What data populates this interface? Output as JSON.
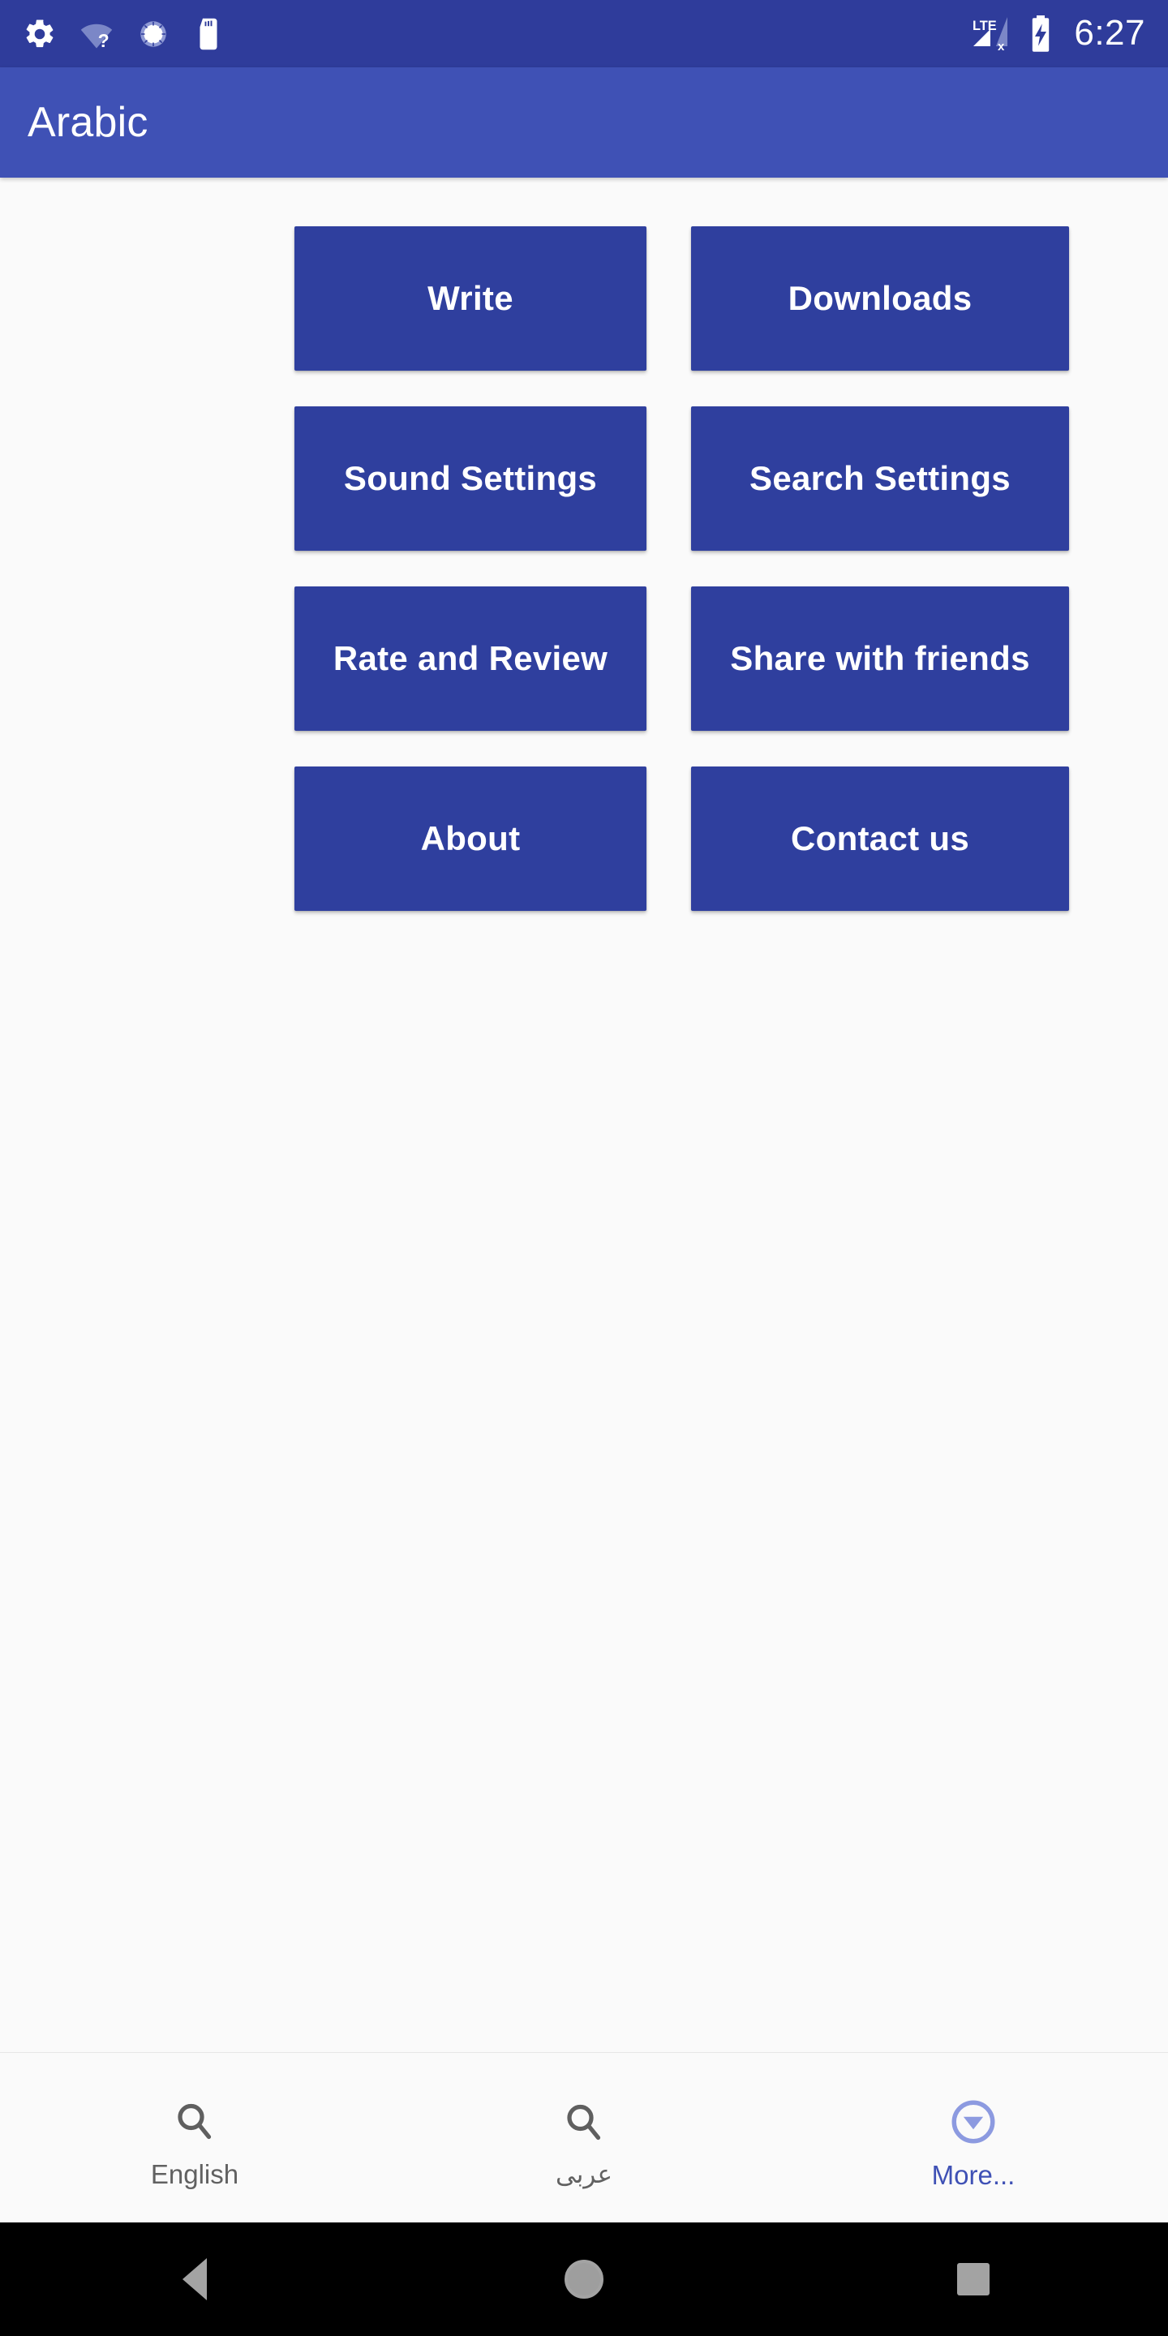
{
  "status_bar": {
    "time": "6:27",
    "icons": [
      {
        "name": "settings-gear-icon"
      },
      {
        "name": "wifi-unknown-icon"
      },
      {
        "name": "sync-circle-icon"
      },
      {
        "name": "sd-card-icon"
      }
    ],
    "right_icons": [
      {
        "name": "lte-signal-no-service-icon",
        "label": "LTE"
      },
      {
        "name": "battery-charging-icon"
      }
    ],
    "background_color": "#2f3c9b"
  },
  "app_bar": {
    "title": "Arabic",
    "background_color": "#3f51b5",
    "text_color": "#ffffff"
  },
  "main": {
    "button_color": "#2f3f9e",
    "button_text_color": "#ffffff",
    "buttons": [
      {
        "label": "Write",
        "name": "write-button"
      },
      {
        "label": "Downloads",
        "name": "downloads-button"
      },
      {
        "label": "Sound Settings",
        "name": "sound-settings-button"
      },
      {
        "label": "Search Settings",
        "name": "search-settings-button"
      },
      {
        "label": "Rate and Review",
        "name": "rate-and-review-button"
      },
      {
        "label": "Share with friends",
        "name": "share-with-friends-button"
      },
      {
        "label": "About",
        "name": "about-button"
      },
      {
        "label": "Contact us",
        "name": "contact-us-button"
      }
    ]
  },
  "bottom_nav": {
    "items": [
      {
        "label": "English",
        "icon": "search-icon",
        "active": false,
        "color": "#616161"
      },
      {
        "label": "عربى",
        "icon": "search-icon",
        "active": false,
        "color": "#616161"
      },
      {
        "label": "More...",
        "icon": "more-circle-down-icon",
        "active": true,
        "color": "#3f51b5"
      }
    ]
  },
  "system_nav": {
    "back_label": "back-button",
    "home_label": "home-button",
    "recents_label": "recents-button"
  }
}
